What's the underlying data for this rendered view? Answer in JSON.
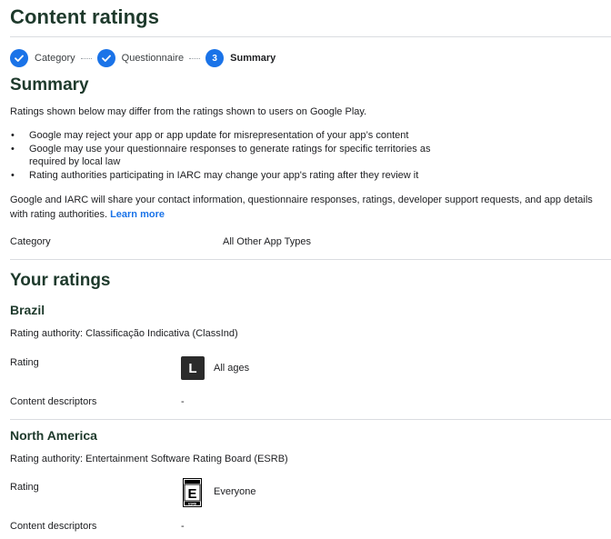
{
  "page_title": "Content ratings",
  "stepper": {
    "steps": [
      {
        "label": "Category",
        "state": "done",
        "icon": "checkmark-icon"
      },
      {
        "label": "Questionnaire",
        "state": "done",
        "icon": "checkmark-icon"
      },
      {
        "label": "Summary",
        "state": "current",
        "number": "3"
      }
    ]
  },
  "summary": {
    "heading": "Summary",
    "intro": "Ratings shown below may differ from the ratings shown to users on Google Play.",
    "bullets": [
      "Google may reject your app or app update for misrepresentation of your app’s content",
      "Google may use your questionnaire responses to generate ratings for specific territories as required by local law",
      "Rating authorities participating in IARC may change your app's rating after they review it"
    ],
    "sharing_text": "Google and IARC will share your contact information, questionnaire responses, ratings, developer support requests, and app details with rating authorities.",
    "learn_more": "Learn more",
    "category_label": "Category",
    "category_value": "All Other App Types"
  },
  "ratings": {
    "heading": "Your ratings",
    "regions": [
      {
        "name": "Brazil",
        "authority": "Rating authority: Classificação Indicativa (ClassInd)",
        "rating_label": "Rating",
        "rating_badge": "L",
        "rating_value": "All ages",
        "descriptors_label": "Content descriptors",
        "descriptors_value": "-"
      },
      {
        "name": "North America",
        "authority": "Rating authority: Entertainment Software Rating Board (ESRB)",
        "rating_label": "Rating",
        "rating_badge": "E",
        "rating_badge_text": "ESRB",
        "rating_value": "Everyone",
        "descriptors_label": "Content descriptors",
        "descriptors_value": "-"
      }
    ]
  },
  "colors": {
    "accent": "#1a73e8",
    "heading": "#1e3a2c",
    "divider": "#dadce0"
  }
}
